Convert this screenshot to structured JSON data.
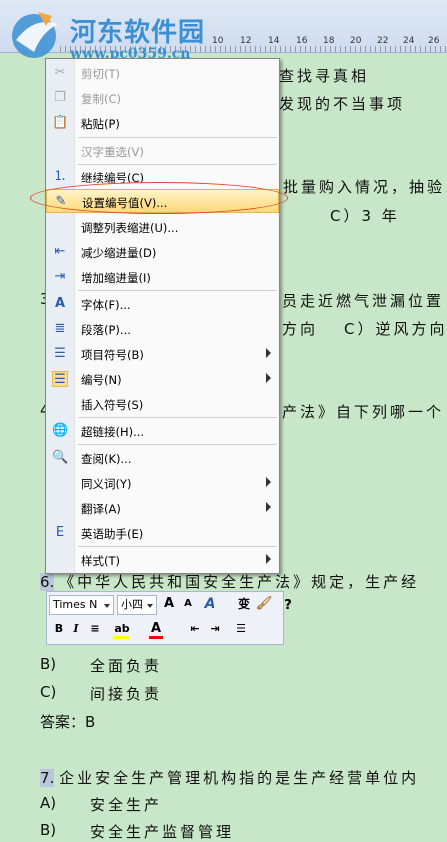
{
  "ruler": {
    "ticks": [
      "10",
      "12",
      "14",
      "16",
      "18",
      "20",
      "22",
      "24",
      "26"
    ]
  },
  "watermark": {
    "title": "河东软件园",
    "url": "www.pc0359.cn"
  },
  "document": {
    "frag1": "查找寻真相",
    "frag2": "发现的不当事项",
    "frag3": "批量购入情况，抽验",
    "frag4": "C）3 年",
    "frag5": "员走近燃气泄漏位置",
    "frag6": "方向",
    "frag7": "C）逆风方向",
    "frag8": "产法》自下列哪一个",
    "num3": "3",
    "num4": "4",
    "q6_num": "6.",
    "q6_text": "《中华人民共和国安全生产法》规定，生产经",
    "optB_label": "B)",
    "optB_text": "全面负责",
    "optC_label": "C)",
    "optC_text": "间接负责",
    "answer": "答案：B",
    "q7_num": "7.",
    "q7_text": "企业安全生产管理机构指的是生产经营单位内",
    "q7_A_label": "A)",
    "q7_A_text": "安全生产",
    "q7_B_label": "B)",
    "q7_B_text": "安全生产监督管理"
  },
  "context_menu": {
    "cut": "剪切(T)",
    "copy": "复制(C)",
    "paste": "粘贴(P)",
    "reconvert": "汉字重选(V)",
    "continue_num": "继续编号(C)",
    "set_num_value": "设置编号值(V)...",
    "adjust_indent": "调整列表缩进(U)...",
    "decrease_indent": "减少缩进量(D)",
    "increase_indent": "增加缩进量(I)",
    "font": "字体(F)...",
    "paragraph": "段落(P)...",
    "bullets": "项目符号(B)",
    "numbering": "编号(N)",
    "insert_symbol": "插入符号(S)",
    "hyperlink": "超链接(H)...",
    "lookup": "查阅(K)...",
    "synonyms": "同义词(Y)",
    "translate": "翻译(A)",
    "english_assistant": "英语助手(E)",
    "styles": "样式(T)"
  },
  "mini_toolbar": {
    "font": "Times N",
    "size": "小四",
    "grow": "A",
    "shrink": "A",
    "styles_a": "A",
    "phonetic": "变",
    "help": "?",
    "bold": "B",
    "italic": "I",
    "font_color": "A",
    "highlight_color": "#ffff00",
    "font_color_value": "#ff0000"
  },
  "colors": {
    "page_bg": "#c8e6c8",
    "menu_hot": "#ffd87a",
    "annotation": "#e0442d",
    "watermark": "#3b8fd4"
  }
}
